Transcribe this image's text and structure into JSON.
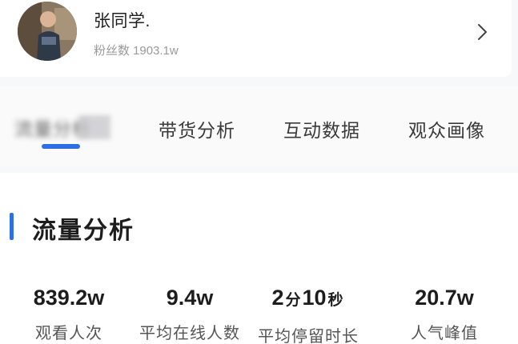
{
  "profile": {
    "name": "张同学.",
    "fans_label": "粉丝数",
    "fans_value": "1903.1w"
  },
  "tabs": [
    {
      "label": "流量分析",
      "active": true
    },
    {
      "label": "带货分析",
      "active": false
    },
    {
      "label": "互动数据",
      "active": false
    },
    {
      "label": "观众画像",
      "active": false
    }
  ],
  "section": {
    "title": "流量分析"
  },
  "metrics": [
    {
      "value": "839.2w",
      "label": "观看人次"
    },
    {
      "value": "9.4w",
      "label": "平均在线人数"
    },
    {
      "value_minutes": "2",
      "unit_minutes": "分",
      "value_seconds": "10",
      "unit_seconds": "秒",
      "label": "平均停留时长"
    },
    {
      "value": "20.7w",
      "label": "人气峰值"
    }
  ],
  "colors": {
    "accent": "#2f6fe4",
    "background": "#f7f8fa",
    "card": "#ffffff"
  },
  "icons": {
    "chevron": "chevron-right-icon"
  }
}
